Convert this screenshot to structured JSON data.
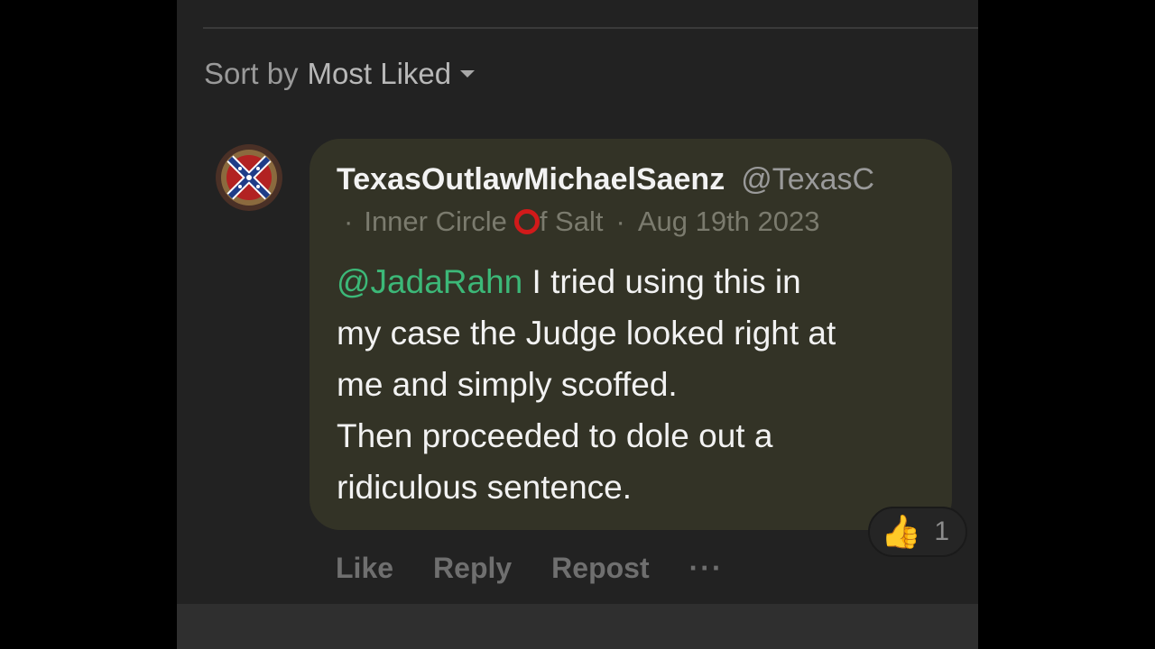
{
  "sort": {
    "label": "Sort by",
    "value": "Most Liked",
    "caret_icon": "caret-down-icon"
  },
  "comment": {
    "avatar_icon": "battle-flag-avatar-icon",
    "author_name": "TexasOutlawMichaelSaenz",
    "author_handle": "@TexasC",
    "meta_separator": "·",
    "group_before_ring": "Inner Circle",
    "group_after_ring": "f Salt",
    "date": "Aug 19th 2023",
    "mention": "@JadaRahn",
    "body_lines": [
      " I tried using this in",
      "my case the Judge looked right at",
      "me and simply scoffed.",
      "Then proceeded to dole out a",
      "ridiculous sentence."
    ],
    "reaction": {
      "emoji": "👍",
      "count": "1"
    }
  },
  "actions": {
    "like": "Like",
    "reply": "Reply",
    "repost": "Repost",
    "more": "···"
  },
  "colors": {
    "background": "#222222",
    "bubble": "#333326",
    "mention": "#3cb878",
    "ring_annotation": "#d11a1a"
  }
}
